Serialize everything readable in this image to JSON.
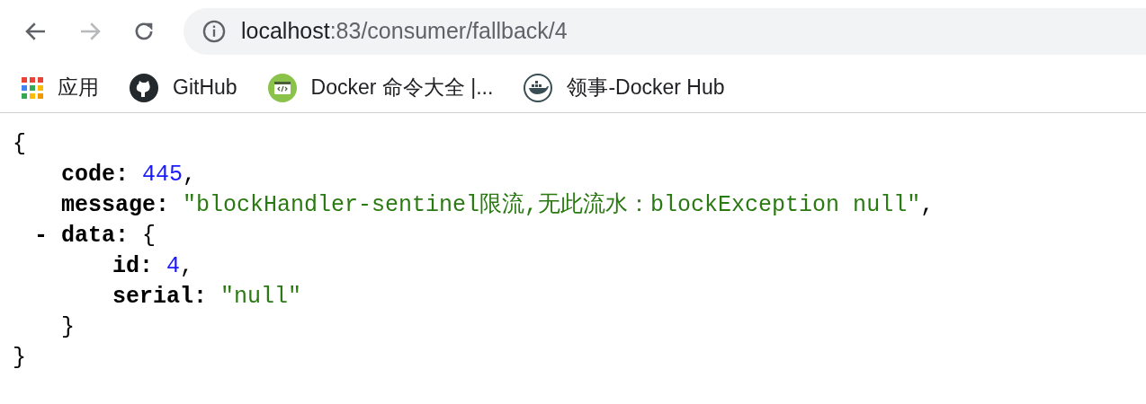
{
  "toolbar": {
    "back_enabled": true,
    "forward_enabled": false,
    "url_host": "localhost",
    "url_path": ":83/consumer/fallback/4"
  },
  "bookmarks": [
    {
      "kind": "apps",
      "label": "应用"
    },
    {
      "kind": "github",
      "label": "GitHub"
    },
    {
      "kind": "code",
      "label": "Docker 命令大全 |..."
    },
    {
      "kind": "whale",
      "label": "领事-Docker Hub"
    }
  ],
  "json_view": {
    "open": "{",
    "close": "}",
    "members": [
      {
        "key": "code:",
        "value": "445",
        "kind": "number",
        "comma": ","
      },
      {
        "key": "message:",
        "value": "\"blockHandler-sentinel限流,无此流水：blockException null\"",
        "kind": "string",
        "comma": ","
      },
      {
        "key": "data:",
        "toggle": "-",
        "kind": "object",
        "open": "{",
        "close": "}",
        "children": [
          {
            "key": "id:",
            "value": "4",
            "kind": "number",
            "comma": ","
          },
          {
            "key": "serial:",
            "value": "\"null\"",
            "kind": "string"
          }
        ]
      }
    ]
  }
}
